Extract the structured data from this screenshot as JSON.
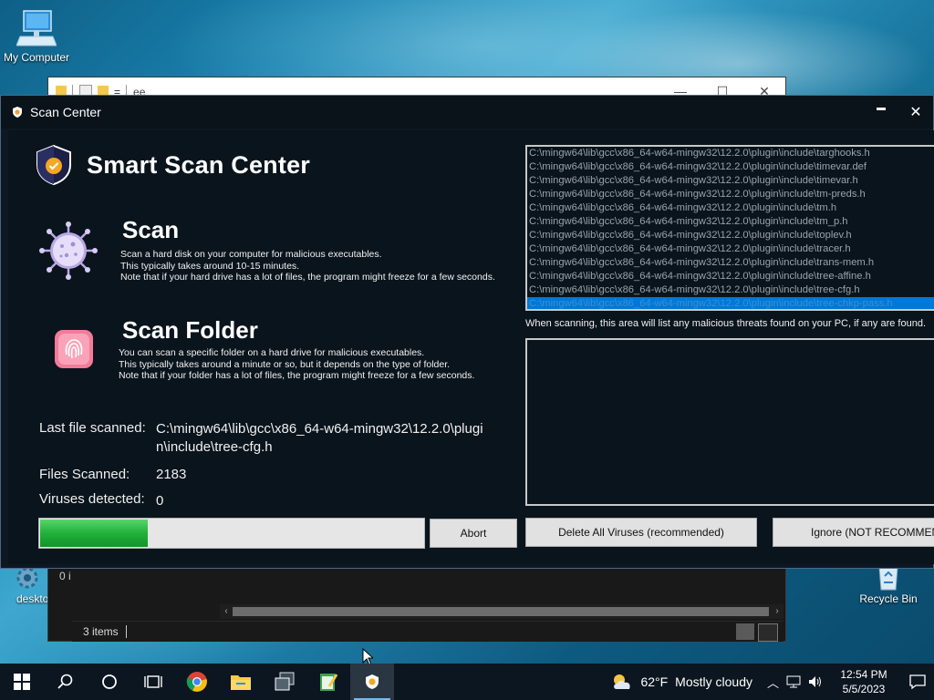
{
  "desktop": {
    "icons": {
      "my_computer": "My Computer",
      "desktop_partial": "deskto",
      "recycle_bin": "Recycle Bin"
    }
  },
  "explorer": {
    "title_fragment": "ee",
    "items_count": "3 items",
    "nav_partial": "0 i"
  },
  "window": {
    "title": "Scan Center",
    "controls": {
      "minimize": "▬",
      "close": "✕"
    }
  },
  "app": {
    "brand_title": "Smart Scan Center",
    "scan": {
      "title": "Scan",
      "desc_lines": [
        "Scan a hard disk on your computer for malicious executables.",
        "This typically takes around 10-15 minutes.",
        "Note that if your hard drive has a lot of files, the program might freeze for a few seconds."
      ]
    },
    "scan_folder": {
      "title": "Scan Folder",
      "desc_lines": [
        "You can scan a specific folder on a hard drive for malicious executables.",
        "This typically takes around a minute or so, but it depends on the type of folder.",
        "Note that if your folder has a lot of files, the program might freeze for a few seconds."
      ]
    },
    "stats": {
      "last_file_label": "Last file scanned:",
      "last_file_line1": "C:\\mingw64\\lib\\gcc\\x86_64-w64-mingw32\\12.2.0\\plugi",
      "last_file_line2": "n\\include\\tree-cfg.h",
      "files_scanned_label": "Files Scanned:",
      "files_scanned_value": "2183",
      "viruses_label": "Viruses detected:",
      "viruses_value": "0"
    },
    "progress_fraction": 0.28,
    "buttons": {
      "abort": "Abort",
      "delete_all": "Delete All Viruses (recommended)",
      "ignore": "Ignore (NOT RECOMMENDED)"
    },
    "file_list": [
      "C:\\mingw64\\lib\\gcc\\x86_64-w64-mingw32\\12.2.0\\plugin\\include\\targhooks.h",
      "C:\\mingw64\\lib\\gcc\\x86_64-w64-mingw32\\12.2.0\\plugin\\include\\timevar.def",
      "C:\\mingw64\\lib\\gcc\\x86_64-w64-mingw32\\12.2.0\\plugin\\include\\timevar.h",
      "C:\\mingw64\\lib\\gcc\\x86_64-w64-mingw32\\12.2.0\\plugin\\include\\tm-preds.h",
      "C:\\mingw64\\lib\\gcc\\x86_64-w64-mingw32\\12.2.0\\plugin\\include\\tm.h",
      "C:\\mingw64\\lib\\gcc\\x86_64-w64-mingw32\\12.2.0\\plugin\\include\\tm_p.h",
      "C:\\mingw64\\lib\\gcc\\x86_64-w64-mingw32\\12.2.0\\plugin\\include\\toplev.h",
      "C:\\mingw64\\lib\\gcc\\x86_64-w64-mingw32\\12.2.0\\plugin\\include\\tracer.h",
      "C:\\mingw64\\lib\\gcc\\x86_64-w64-mingw32\\12.2.0\\plugin\\include\\trans-mem.h",
      "C:\\mingw64\\lib\\gcc\\x86_64-w64-mingw32\\12.2.0\\plugin\\include\\tree-affine.h",
      "C:\\mingw64\\lib\\gcc\\x86_64-w64-mingw32\\12.2.0\\plugin\\include\\tree-cfg.h",
      "C:\\mingw64\\lib\\gcc\\x86_64-w64-mingw32\\12.2.0\\plugin\\include\\tree-chkp-pass.h"
    ],
    "threats_hint": "When scanning, this area will list any malicious threats found on your PC, if any are found."
  },
  "taskbar": {
    "weather_temp": "62°F",
    "weather_text": "Mostly cloudy",
    "time": "12:54 PM",
    "date": "5/5/2023"
  },
  "colors": {
    "accent": "#0078d7",
    "progress_green": "#22b03a",
    "window_bg": "#0a141d"
  }
}
